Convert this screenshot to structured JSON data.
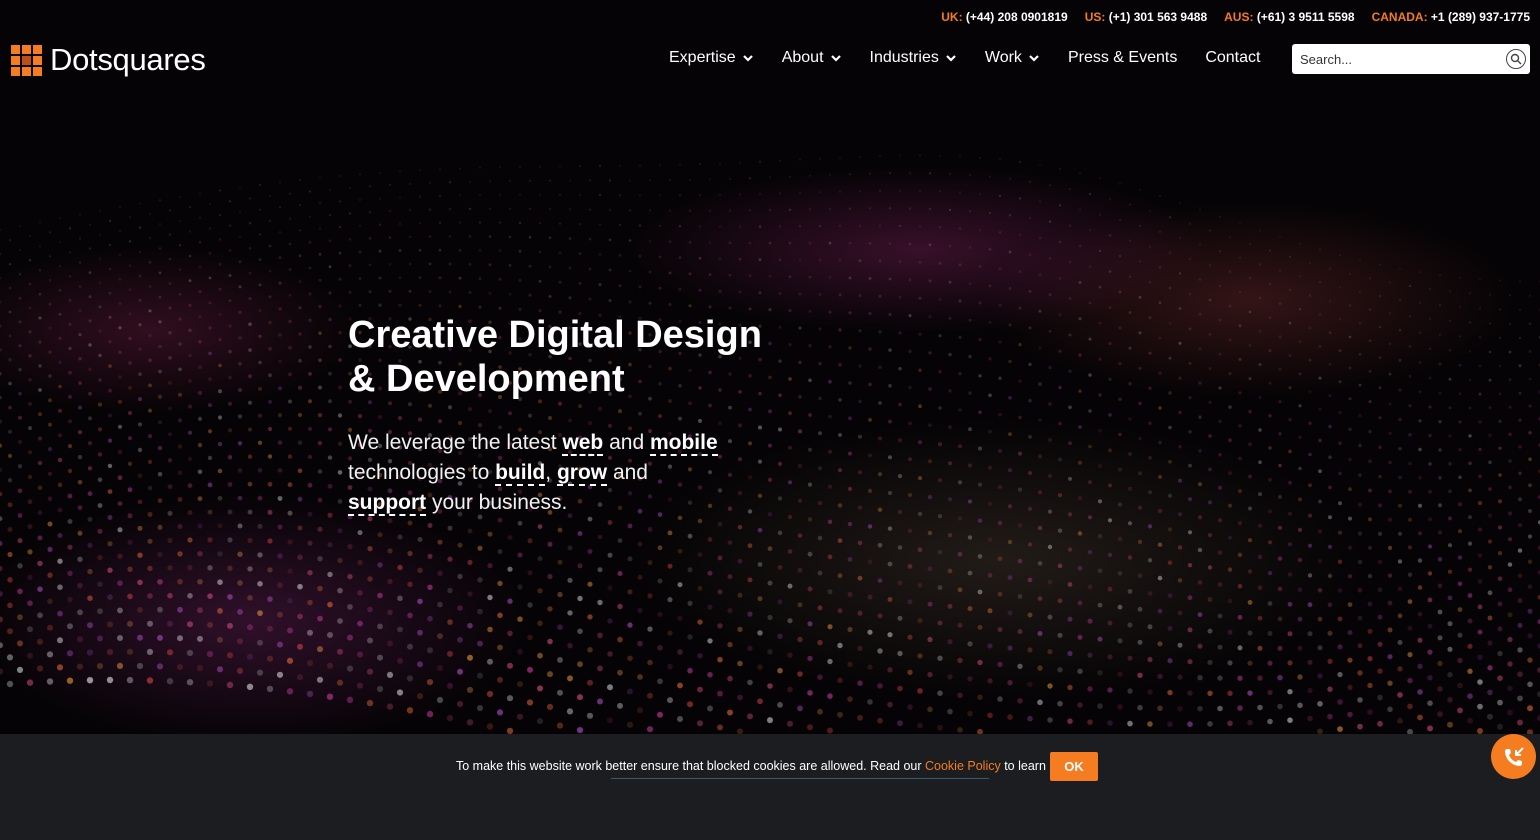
{
  "topbar": {
    "contacts": [
      {
        "region": "UK:",
        "phone": "(+44) 208 0901819"
      },
      {
        "region": "US:",
        "phone": "(+1) 301 563 9488"
      },
      {
        "region": "AUS:",
        "phone": "(+61) 3 9511 5598"
      },
      {
        "region": "CANADA:",
        "phone": "+1 (289) 937-1775"
      }
    ]
  },
  "logo": {
    "text": "Dotsquares"
  },
  "nav": {
    "items": [
      {
        "label": "Expertise",
        "dropdown": true
      },
      {
        "label": "About",
        "dropdown": true
      },
      {
        "label": "Industries",
        "dropdown": true
      },
      {
        "label": "Work",
        "dropdown": true
      },
      {
        "label": "Press & Events",
        "dropdown": false
      },
      {
        "label": "Contact",
        "dropdown": false
      }
    ]
  },
  "search": {
    "placeholder": "Search...",
    "icon": "search-icon"
  },
  "hero": {
    "title_line1": "Creative Digital Design",
    "title_line2": "& Development",
    "sub": {
      "t1": "We leverage the latest ",
      "h1": "web",
      "t2": " and ",
      "h2": "mobile",
      "t3": "technologies to ",
      "h3": "build",
      "t4": ", ",
      "h4": "grow",
      "t5": " and",
      "h5": "support",
      "t6": " your business."
    }
  },
  "cookie": {
    "text_before": "To make this website work better ensure that blocked cookies are allowed. Read our ",
    "link": "Cookie Policy",
    "text_after": " to learn more.",
    "ok_label": "OK"
  },
  "colors": {
    "accent": "#f57c20",
    "background": "#000000",
    "cookie_bar": "#1b1d21"
  }
}
